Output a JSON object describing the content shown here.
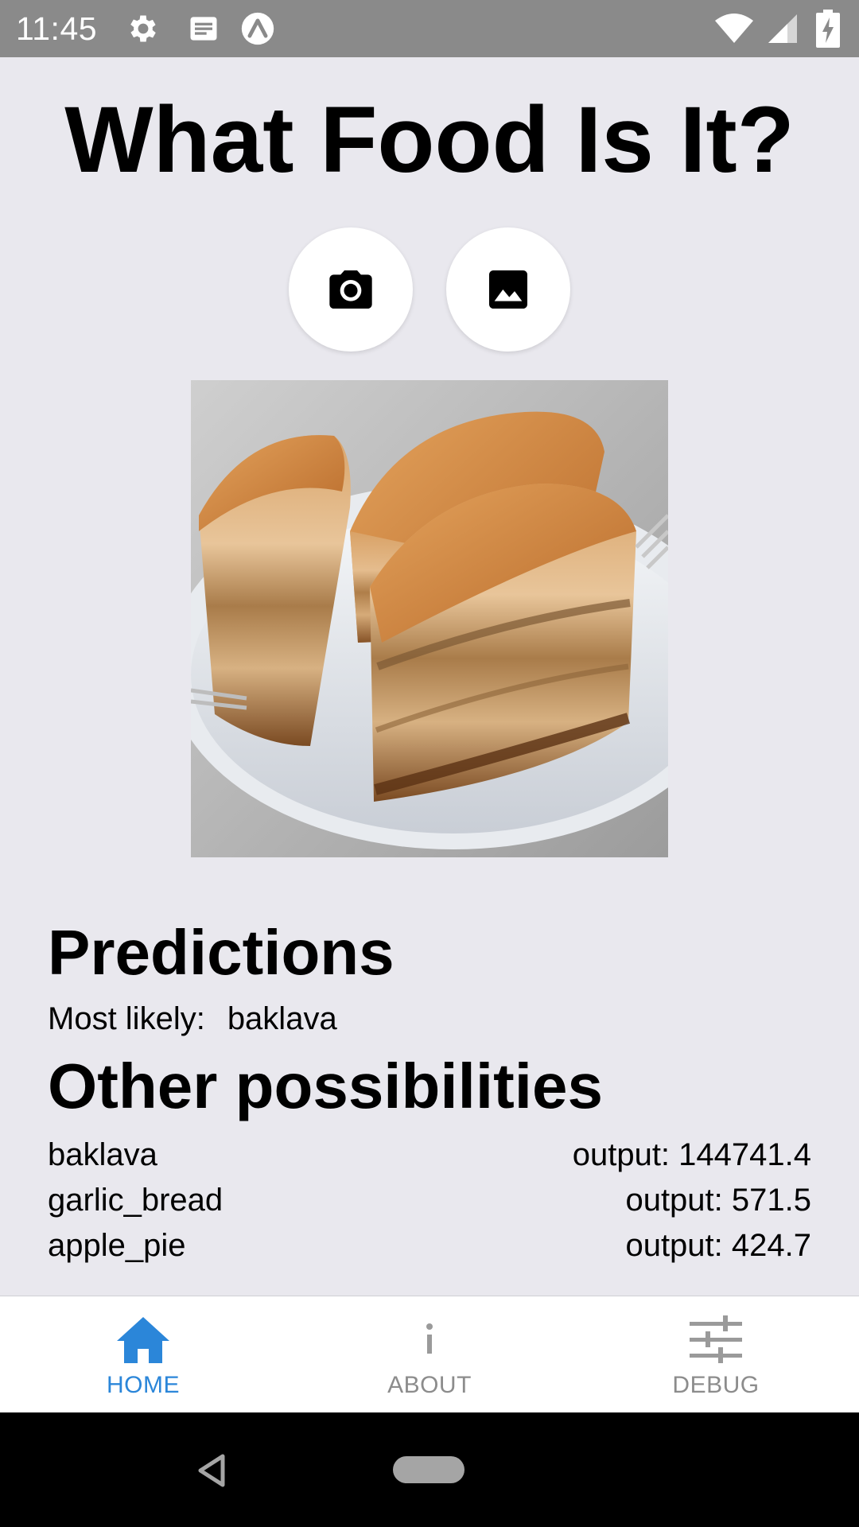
{
  "status_bar": {
    "time": "11:45",
    "icons": [
      "gear-icon",
      "news-icon",
      "expo-icon",
      "wifi-icon",
      "signal-icon",
      "battery-charging-icon"
    ],
    "background": "#8a8a8a"
  },
  "header": {
    "title": "What Food Is It?"
  },
  "actions": {
    "camera_icon": "camera-icon",
    "gallery_icon": "image-icon"
  },
  "photo": {
    "subject": "baklava-photo"
  },
  "predictions": {
    "heading": "Predictions",
    "most_likely_label": "Most likely:",
    "most_likely_value": "baklava",
    "other_heading": "Other possibilities",
    "items": [
      {
        "label": "baklava",
        "output": "output: 144741.4"
      },
      {
        "label": "garlic_bread",
        "output": "output: 571.5"
      },
      {
        "label": "apple_pie",
        "output": "output: 424.7"
      }
    ]
  },
  "bottom_nav": {
    "tabs": [
      {
        "label": "HOME",
        "icon": "home-icon",
        "active": true
      },
      {
        "label": "ABOUT",
        "icon": "info-icon",
        "active": false
      },
      {
        "label": "DEBUG",
        "icon": "sliders-icon",
        "active": false
      }
    ],
    "active_color": "#2b86d9",
    "inactive_color": "#8c8c8c"
  },
  "system_nav": {
    "buttons": [
      "back-icon",
      "home-pill"
    ]
  }
}
